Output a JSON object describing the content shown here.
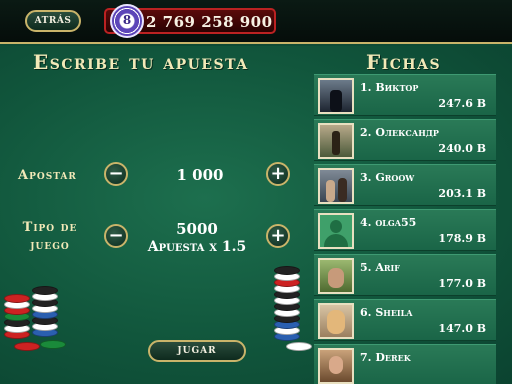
{
  "topbar": {
    "back_label": "ATRÁS",
    "balance": "2 769 258 900",
    "chip_number": "8"
  },
  "bet_section": {
    "title": "Escribe tu apuesta",
    "bet_label": "Apostar",
    "bet_value": "1 000",
    "type_label_line1": "Tipo de",
    "type_label_line2": "juego",
    "type_value": "5000",
    "type_desc": "Apuesta x 1.5",
    "minus": "−",
    "plus": "+",
    "play_label": "JUGAR"
  },
  "leaderboard": {
    "title": "Fichas",
    "players": [
      {
        "rank": "1.",
        "name": "Виктор",
        "value": "247.6 B",
        "avatar": "suit-photo"
      },
      {
        "rank": "2.",
        "name": "Олександр",
        "value": "240.0 B",
        "avatar": "street-photo"
      },
      {
        "rank": "3.",
        "name": "Groow",
        "value": "203.1 B",
        "avatar": "group-photo"
      },
      {
        "rank": "4.",
        "name": "olga55",
        "value": "178.9 B",
        "avatar": "default-avatar-icon"
      },
      {
        "rank": "5.",
        "name": "Arif",
        "value": "177.0 B",
        "avatar": "man-photo"
      },
      {
        "rank": "6.",
        "name": "Sheila",
        "value": "147.0 B",
        "avatar": "woman-photo"
      },
      {
        "rank": "7.",
        "name": "Derek",
        "value": "",
        "avatar": "man-photo"
      }
    ]
  },
  "colors": {
    "felt": "#11563c",
    "gold": "#c9b46a",
    "heading": "#f2e9b8",
    "balance_bg": "#5a0a0a"
  }
}
